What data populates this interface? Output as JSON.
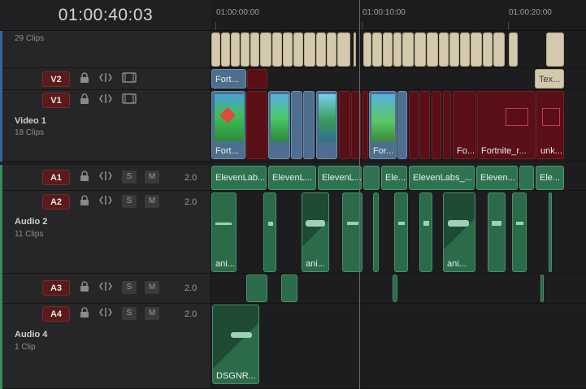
{
  "timecode": "01:00:40:03",
  "ruler": {
    "marks": [
      "01:00:00:00",
      "01:00:10:00",
      "01:00:20:00"
    ]
  },
  "tracks": {
    "v3": {
      "sub": "29 Clips"
    },
    "v2": {
      "badge": "V2"
    },
    "v1": {
      "badge": "V1",
      "name": "Video 1",
      "sub": "18 Clips"
    },
    "a1": {
      "badge": "A1",
      "channels": "2.0"
    },
    "a2": {
      "badge": "A2",
      "channels": "2.0",
      "name": "Audio 2",
      "sub": "11 Clips"
    },
    "a3": {
      "badge": "A3",
      "channels": "2.0"
    },
    "a4": {
      "badge": "A4",
      "channels": "2.0",
      "name": "Audio 4",
      "sub": "1 Clip"
    }
  },
  "buttons": {
    "solo": "S",
    "mute": "M"
  },
  "icons": {
    "lock": "lock-icon",
    "link": "link-icon",
    "monitor": "film-icon"
  },
  "clips": {
    "v2_a": "Fort...",
    "v2_b": "Tex...",
    "v1_a": "Fort...",
    "v1_b": "For...",
    "v1_c": "Fo...",
    "v1_d": "Fortnite_r...",
    "v1_e": "unk...",
    "a1_a": "ElevenLab...",
    "a1_b": "ElevenL...",
    "a1_c": "ElevenL...",
    "a1_d": "Ele...",
    "a1_e": "ElevenLabs_...",
    "a1_f": "Eleven...",
    "a1_g": "Ele...",
    "a2_a": "ani...",
    "a2_b": "ani...",
    "a2_c": "ani...",
    "a4_a": "DSGNR..."
  },
  "colors": {
    "video": "#4a78b0",
    "audio": "#3a8a5a",
    "red": "#5a0e16",
    "green": "#2e7350",
    "beige": "#d4c9ad"
  }
}
